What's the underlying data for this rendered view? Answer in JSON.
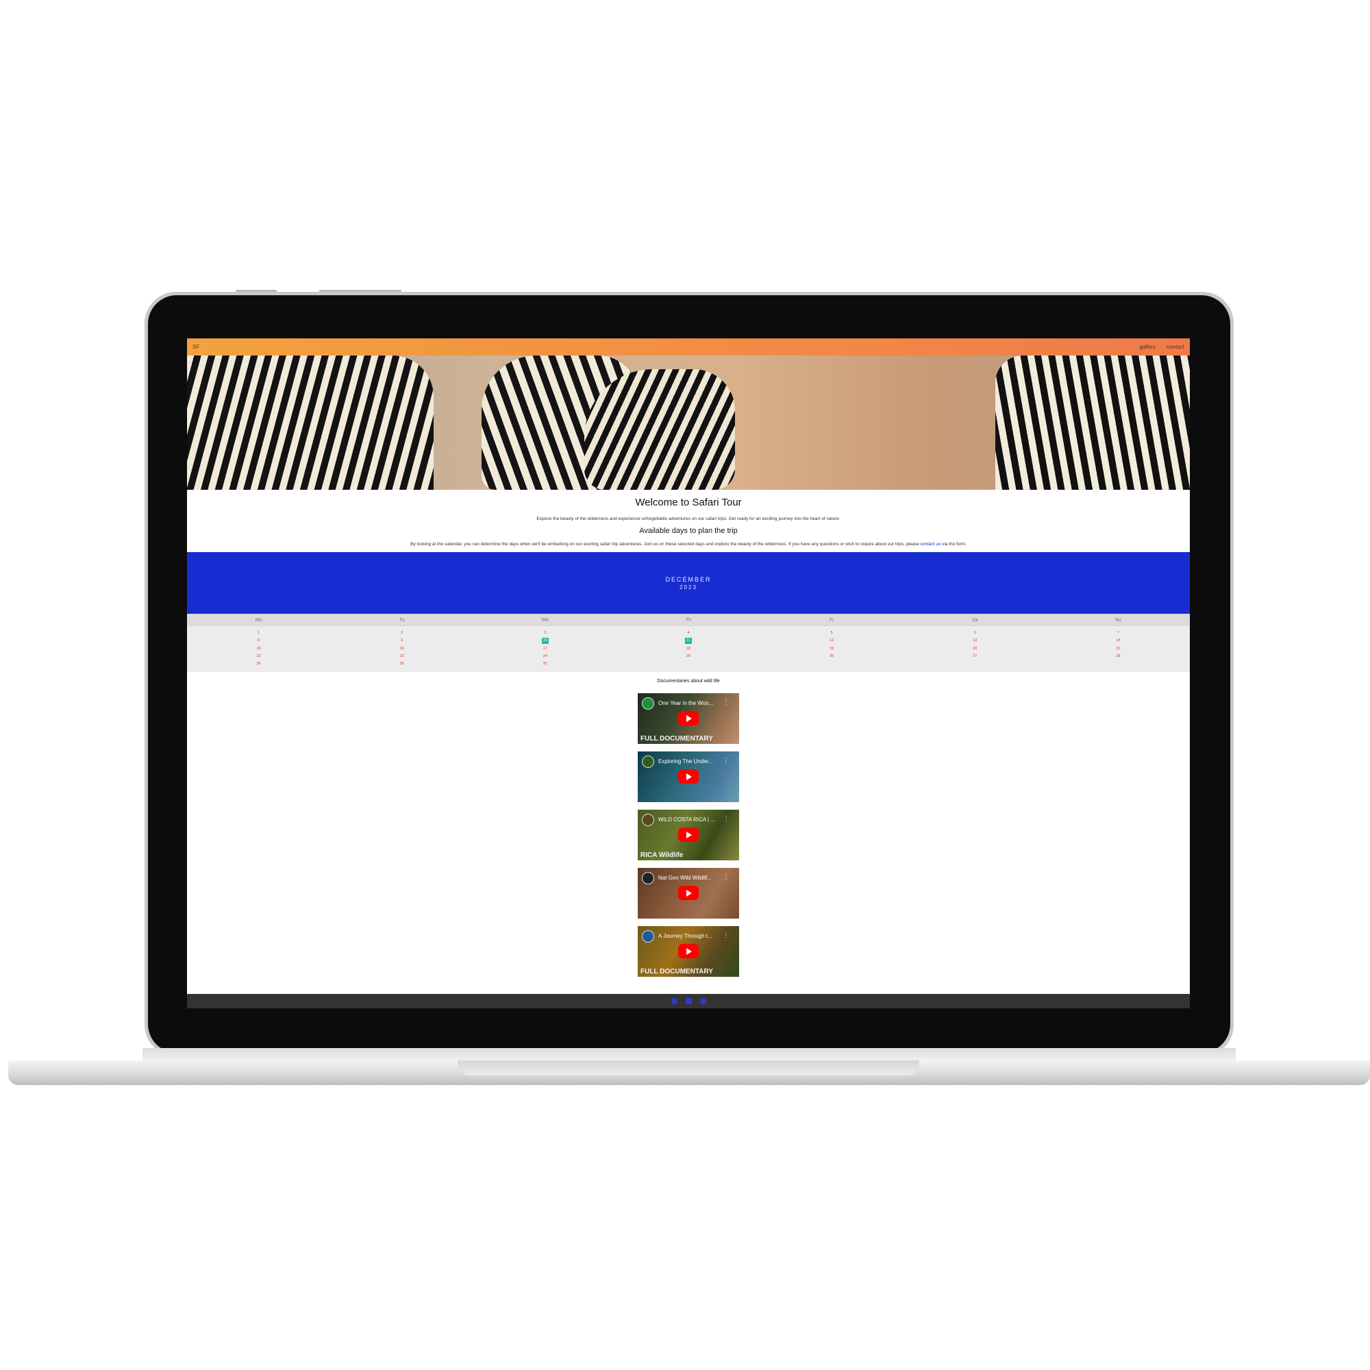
{
  "nav": {
    "logo": "SF",
    "links": [
      "gallery",
      "contact"
    ]
  },
  "intro": {
    "title": "Welcome to Safari Tour",
    "subtitle": "Explore the beauty of the wilderness and experience unforgettable adventures on our safari trips. Get ready for an exciting journey into the heart of nature.",
    "heading": "Available days to plan the trip",
    "description_before": "By looking at the calendar, you can determine the days when we'll be embarking on our exciting safari trip adventures. Join us on these selected days and explore the beauty of the wilderness. If you have any questions or wish to inquire about our trips, please",
    "contact_link": "contact us",
    "description_after": "via the form."
  },
  "calendar": {
    "month": "DECEMBER",
    "year": "2023",
    "weekdays": [
      "Mo",
      "Tu",
      "We",
      "Th",
      "Fr",
      "Sa",
      "Su"
    ],
    "days": [
      "1",
      "2",
      "3",
      "4",
      "5",
      "6",
      "7",
      "8",
      "9",
      "10",
      "11",
      "12",
      "13",
      "14",
      "15",
      "16",
      "17",
      "18",
      "19",
      "20",
      "21",
      "22",
      "23",
      "24",
      "25",
      "26",
      "27",
      "28",
      "29",
      "30",
      "31",
      "",
      "",
      "",
      ""
    ],
    "selected_days": [
      "10",
      "11"
    ],
    "highlight_color": "#1abc9c",
    "header_color": "#182dd1"
  },
  "documentaries": {
    "heading": "Documentaries about wild life",
    "videos": [
      {
        "title": "One Year in the Woo...",
        "badge": "FULL DOCUMENTARY"
      },
      {
        "title": "Exploring The Under...",
        "badge": ""
      },
      {
        "title": "WILD COSTA RICA | ...",
        "badge": "RICA Wildlife"
      },
      {
        "title": "Nat Geo Wild Wildlif...",
        "badge": ""
      },
      {
        "title": "A Journey Through t...",
        "badge": "FULL DOCUMENTARY"
      }
    ]
  },
  "footer": {
    "icons": [
      "facebook-icon",
      "instagram-icon",
      "twitter-icon"
    ]
  }
}
